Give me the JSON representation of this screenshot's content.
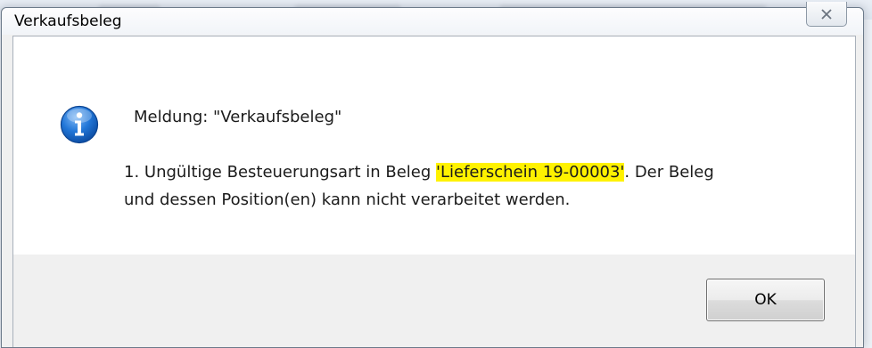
{
  "dialog": {
    "title": "Verkaufsbeleg",
    "close_icon": "close-icon",
    "message_icon": "info-icon",
    "message_title": "Meldung: \"Verkaufsbeleg\"",
    "body_line1_prefix": "1. Ungültige Besteuerungsart in Beleg ",
    "body_line1_highlight": "'Lieferschein 19-00003'",
    "body_line1_suffix": ". Der Beleg",
    "body_line2": "und dessen Position(en) kann nicht verarbeitet werden.",
    "ok_label": "OK"
  },
  "colors": {
    "highlight": "#fff200",
    "info_icon_blue": "#1d6fd1"
  }
}
